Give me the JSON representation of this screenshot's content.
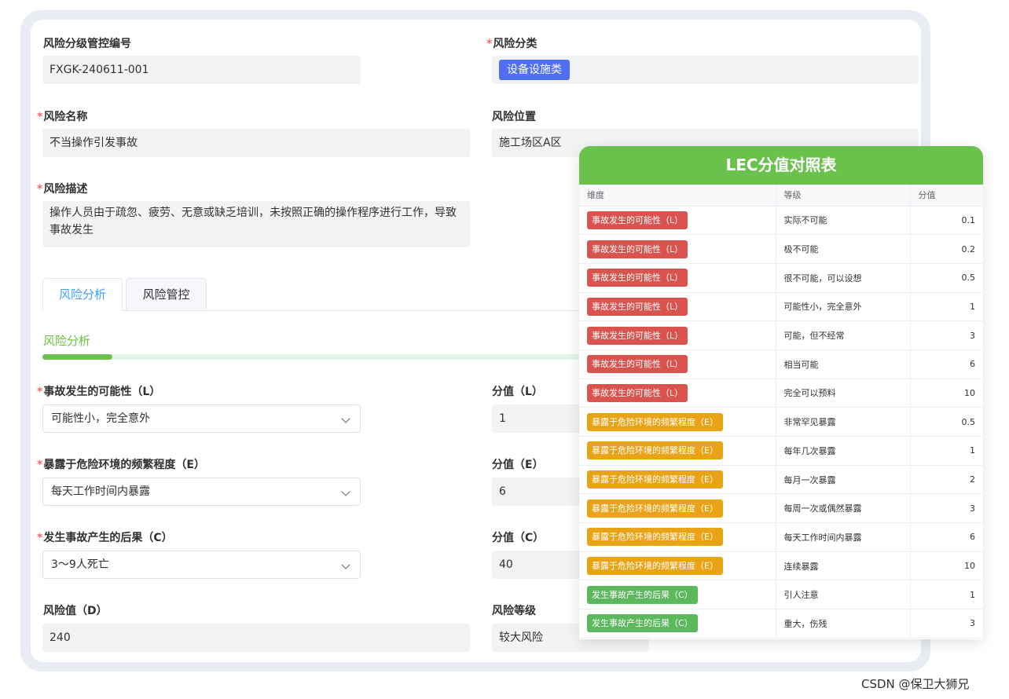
{
  "form": {
    "code": {
      "label": "风险分级管控编号",
      "value": "FXGK-240611-001"
    },
    "category": {
      "required": "*",
      "label": "风险分类",
      "tag": "设备设施类"
    },
    "name": {
      "required": "*",
      "label": "风险名称",
      "value": "不当操作引发事故"
    },
    "location": {
      "label": "风险位置",
      "value": "施工场区A区"
    },
    "description": {
      "required": "*",
      "label": "风险描述",
      "value": "操作人员由于疏忽、疲劳、无意或缺乏培训，未按照正确的操作程序进行工作，导致事故发生"
    }
  },
  "tabs": [
    {
      "label": "风险分析",
      "active": true
    },
    {
      "label": "风险管控",
      "active": false
    }
  ],
  "analysis": {
    "section_title": "风险分析",
    "progress_fraction": 0.08,
    "likelihood": {
      "required": "*",
      "label": "事故发生的可能性（L）",
      "selected": "可能性小，完全意外",
      "score_label": "分值（L）",
      "score": "1"
    },
    "exposure": {
      "required": "*",
      "label": "暴露于危险环境的频繁程度（E）",
      "selected": "每天工作时间内暴露",
      "score_label": "分值（E）",
      "score": "6"
    },
    "consequence": {
      "required": "*",
      "label": "发生事故产生的后果（C）",
      "selected": "3～9人死亡",
      "score_label": "分值（C）",
      "score": "40"
    },
    "risk_value": {
      "label": "风险值（D）",
      "value": "240"
    },
    "risk_level": {
      "label": "风险等级",
      "value": "较大风险"
    }
  },
  "lec_table": {
    "title": "LEC分值对照表",
    "headers": [
      "维度",
      "等级",
      "分值"
    ],
    "rows": [
      {
        "dimension": "事故发生的可能性（L）",
        "color": "#d9534f",
        "level": "实际不可能",
        "score": "0.1"
      },
      {
        "dimension": "事故发生的可能性（L）",
        "color": "#d9534f",
        "level": "极不可能",
        "score": "0.2"
      },
      {
        "dimension": "事故发生的可能性（L）",
        "color": "#d9534f",
        "level": "很不可能，可以设想",
        "score": "0.5"
      },
      {
        "dimension": "事故发生的可能性（L）",
        "color": "#d9534f",
        "level": "可能性小，完全意外",
        "score": "1"
      },
      {
        "dimension": "事故发生的可能性（L）",
        "color": "#d9534f",
        "level": "可能，但不经常",
        "score": "3"
      },
      {
        "dimension": "事故发生的可能性（L）",
        "color": "#d9534f",
        "level": "相当可能",
        "score": "6"
      },
      {
        "dimension": "事故发生的可能性（L）",
        "color": "#d9534f",
        "level": "完全可以预料",
        "score": "10"
      },
      {
        "dimension": "暴露于危险环境的频繁程度（E）",
        "color": "#e8a317",
        "level": "非常罕见暴露",
        "score": "0.5"
      },
      {
        "dimension": "暴露于危险环境的频繁程度（E）",
        "color": "#e8a317",
        "level": "每年几次暴露",
        "score": "1"
      },
      {
        "dimension": "暴露于危险环境的频繁程度（E）",
        "color": "#e8a317",
        "level": "每月一次暴露",
        "score": "2"
      },
      {
        "dimension": "暴露于危险环境的频繁程度（E）",
        "color": "#e8a317",
        "level": "每周一次或偶然暴露",
        "score": "3"
      },
      {
        "dimension": "暴露于危险环境的频繁程度（E）",
        "color": "#e8a317",
        "level": "每天工作时间内暴露",
        "score": "6"
      },
      {
        "dimension": "暴露于危险环境的频繁程度（E）",
        "color": "#e8a317",
        "level": "连续暴露",
        "score": "10"
      },
      {
        "dimension": "发生事故产生的后果（C）",
        "color": "#5cb85c",
        "level": "引人注意",
        "score": "1"
      },
      {
        "dimension": "发生事故产生的后果（C）",
        "color": "#5cb85c",
        "level": "重大，伤残",
        "score": "3"
      }
    ]
  },
  "watermark": "CSDN @保卫大狮兄"
}
